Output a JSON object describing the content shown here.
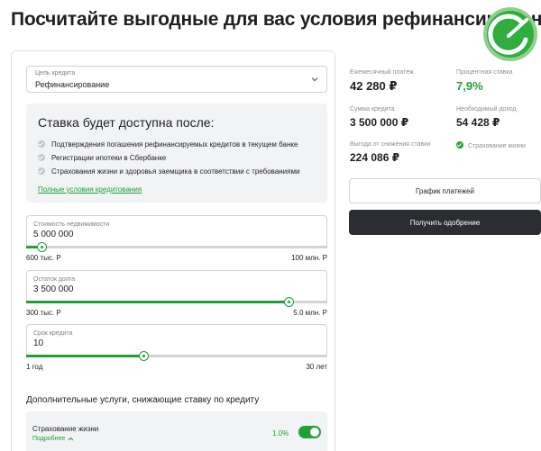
{
  "page": {
    "title": "Посчитайте выгодные для вас условия рефинансирования"
  },
  "credit_purpose": {
    "caption": "Цель кредита",
    "value": "Рефинансирование"
  },
  "rate_block": {
    "title": "Ставка будет доступна после:",
    "conditions": [
      "Подтверждения погашения рефинансируемых кредитов в текущем банке",
      "Регистрации ипотеки в Сбербанке",
      "Страхования жизни и здоровья заемщика в соответствии с требованиями"
    ],
    "link": "Полные условия кредитования"
  },
  "sliders": [
    {
      "caption": "Стоимость недвижимости",
      "value": "5 000 000",
      "min_label": "600 тыс. Р",
      "max_label": "100 млн. Р",
      "fill": 0.05
    },
    {
      "caption": "Остаток долга",
      "value": "3 500 000",
      "min_label": "300 тыс. Р",
      "max_label": "5.0 млн. Р",
      "fill": 0.87
    },
    {
      "caption": "Срок кредита",
      "value": "10",
      "min_label": "1 год",
      "max_label": "30 лет",
      "fill": 0.39
    }
  ],
  "extras": {
    "heading": "Дополнительные услуги, снижающие ставку по кредиту",
    "life_insurance": {
      "label": "Страхование жизни",
      "more": "Подробнее",
      "percent": "1.0%",
      "enabled": true
    }
  },
  "results": {
    "monthly_payment": {
      "label": "Ежемесячный платеж",
      "value": "42 280 ₽"
    },
    "interest_rate": {
      "label": "Процентная ставка",
      "value": "7,9%"
    },
    "credit_amount": {
      "label": "Сумма кредита",
      "value": "3 500 000 ₽"
    },
    "required_income": {
      "label": "Необходимый доход",
      "value": "54 428 ₽"
    },
    "rate_reduction_benefit": {
      "label": "Выгода от снижения ставки",
      "value": "224 086 ₽"
    },
    "life_insurance_note": "Страхование жизни"
  },
  "buttons": {
    "schedule": "График платежей",
    "approve": "Получить одобрение"
  },
  "colors": {
    "accent": "#21a038",
    "dark_button": "#2b2d33",
    "panel_bg": "#f2f3f5"
  }
}
